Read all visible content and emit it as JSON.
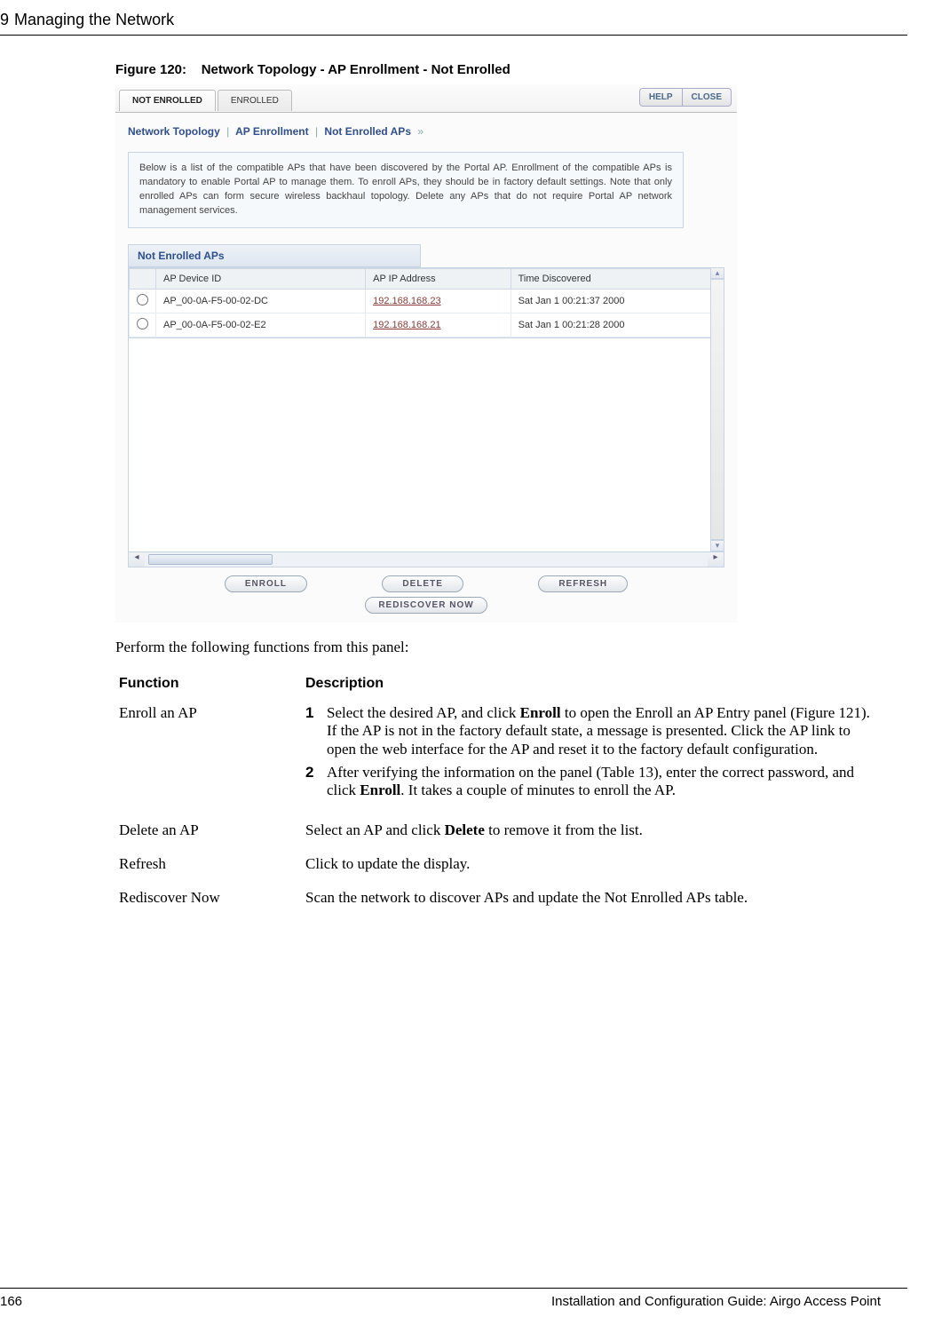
{
  "page_header": {
    "chapter_num": "9",
    "chapter_title": "Managing the Network"
  },
  "figure_caption": {
    "label": "Figure 120:",
    "title": "Network Topology - AP Enrollment - Not Enrolled"
  },
  "screenshot": {
    "tabs": {
      "not_enrolled": "NOT ENROLLED",
      "enrolled": "ENROLLED"
    },
    "help_btn": "HELP",
    "close_btn": "CLOSE",
    "breadcrumb": {
      "a": "Network Topology",
      "b": "AP Enrollment",
      "c": "Not Enrolled APs",
      "tail": "»"
    },
    "infobox_text": "Below is a list of the compatible APs that have been discovered by the Portal AP. Enrollment of the compatible APs is mandatory to enable Portal AP to manage them. To enroll APs, they should be in factory default settings. Note that only enrolled APs can form secure wireless backhaul topology. Delete any APs that do not require Portal AP network management services.",
    "section_title": "Not Enrolled APs",
    "table": {
      "headers": {
        "device_id": "AP Device ID",
        "ip": "AP IP Address",
        "time": "Time Discovered"
      },
      "rows": [
        {
          "device_id": "AP_00-0A-F5-00-02-DC",
          "ip": "192.168.168.23",
          "time": "Sat Jan 1 00:21:37 2000"
        },
        {
          "device_id": "AP_00-0A-F5-00-02-E2",
          "ip": "192.168.168.21",
          "time": "Sat Jan 1 00:21:28 2000"
        }
      ]
    },
    "buttons": {
      "enroll": "ENROLL",
      "delete": "DELETE",
      "refresh": "REFRESH",
      "rediscover": "REDISCOVER NOW"
    }
  },
  "paragraph": "Perform the following functions from this panel:",
  "func_table": {
    "headers": {
      "function": "Function",
      "description": "Description"
    },
    "rows": {
      "enroll": {
        "fn": "Enroll an AP",
        "step1_num": "1",
        "step1_a": "Select the desired AP, and click ",
        "step1_b": "Enroll",
        "step1_c": " to open the Enroll an AP Entry panel (Figure 121). If the AP is not in the factory default state, a message is presented. Click the AP link to open the web interface for the AP and reset it to the factory default configuration.",
        "step2_num": "2",
        "step2_a": "After verifying the information on the panel (Table 13), enter the correct password, and click ",
        "step2_b": "Enroll",
        "step2_c": ". It takes a couple of minutes to enroll the AP."
      },
      "delete": {
        "fn": "Delete an AP",
        "d_a": "Select an AP and click ",
        "d_b": "Delete",
        "d_c": " to remove it from the list."
      },
      "refresh": {
        "fn": "Refresh",
        "desc": "Click to update the display."
      },
      "rediscover": {
        "fn": "Rediscover Now",
        "desc": "Scan the network to discover APs and update the Not Enrolled APs table."
      }
    }
  },
  "footer": {
    "page_num": "166",
    "doc_title": "Installation and Configuration Guide: Airgo Access Point"
  }
}
